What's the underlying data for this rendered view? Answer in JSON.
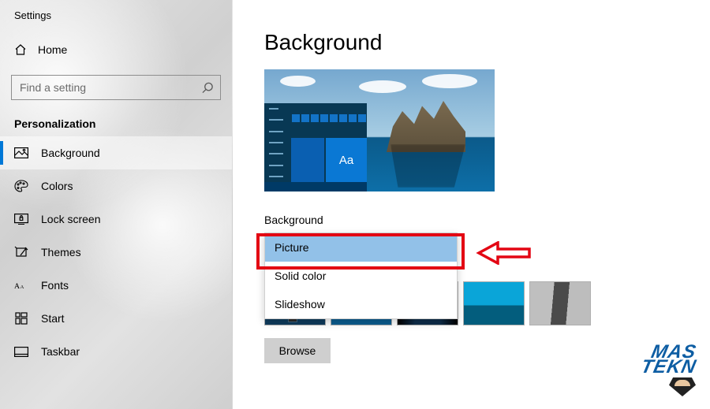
{
  "app_title": "Settings",
  "home_label": "Home",
  "search": {
    "placeholder": "Find a setting"
  },
  "category_label": "Personalization",
  "nav": {
    "background": "Background",
    "colors": "Colors",
    "lock_screen": "Lock screen",
    "themes": "Themes",
    "fonts": "Fonts",
    "start": "Start",
    "taskbar": "Taskbar"
  },
  "main": {
    "title": "Background",
    "preview_tile_text": "Aa",
    "bg_label": "Background",
    "dropdown": {
      "selected": "Picture",
      "options": {
        "picture": "Picture",
        "solid": "Solid color",
        "slideshow": "Slideshow"
      }
    },
    "browse_label": "Browse"
  },
  "watermark": {
    "line1": "MAS",
    "line2": "TEKN"
  },
  "colors": {
    "accent": "#0078d7",
    "highlight_border": "#e30613",
    "dropdown_selected": "#92c1e8"
  }
}
